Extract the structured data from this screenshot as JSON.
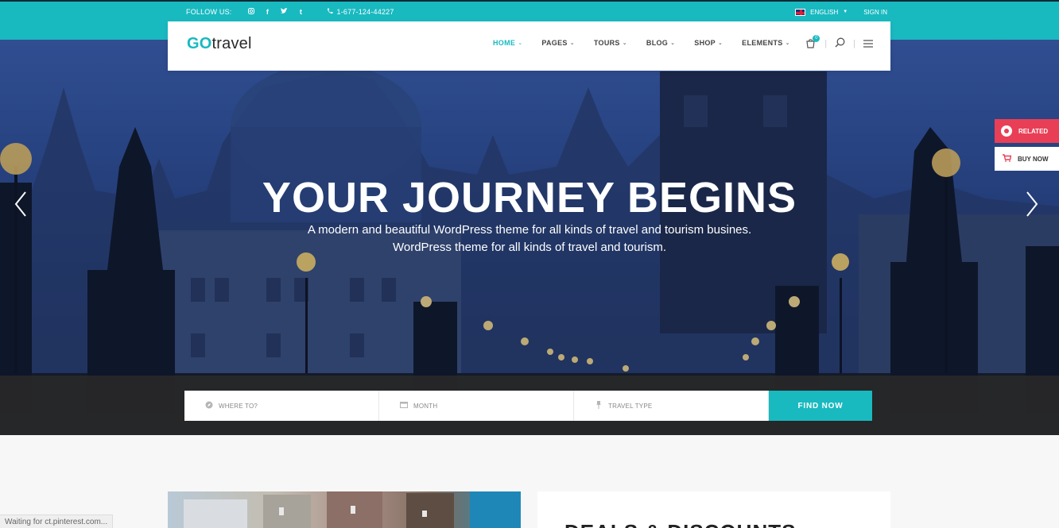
{
  "topbar": {
    "follow_label": "FOLLOW US:",
    "social_icons": [
      "instagram-icon",
      "facebook-icon",
      "twitter-icon",
      "tumblr-icon"
    ],
    "social_glyphs": [
      "◙",
      "f",
      "t",
      "t"
    ],
    "phone": "1-677-124-44227",
    "language": "ENGLISH",
    "sign_in": "SIGN IN"
  },
  "header": {
    "logo_go": "GO",
    "logo_rest": "travel",
    "nav": [
      {
        "label": "HOME",
        "active": true
      },
      {
        "label": "PAGES",
        "active": false
      },
      {
        "label": "TOURS",
        "active": false
      },
      {
        "label": "BLOG",
        "active": false
      },
      {
        "label": "SHOP",
        "active": false
      },
      {
        "label": "ELEMENTS",
        "active": false
      }
    ],
    "cart_count": "0"
  },
  "hero": {
    "title": "YOUR JOURNEY BEGINS",
    "subtitle_line1": "A modern and beautiful WordPress theme for all kinds of travel and tourism busines.",
    "subtitle_line2": "WordPress theme for all kinds of travel and tourism."
  },
  "side": {
    "related": "RELATED",
    "buy_now": "BUY NOW"
  },
  "search": {
    "where": "WHERE TO?",
    "month": "MONTH",
    "travel_type": "TRAVEL TYPE",
    "button": "FIND NOW"
  },
  "deals": {
    "title": "DEALS & DISCOUNTS"
  },
  "status": "Waiting for ct.pinterest.com...",
  "colors": {
    "accent": "#19b9c0",
    "related": "#e83f56",
    "dark_strip": "#282828"
  }
}
